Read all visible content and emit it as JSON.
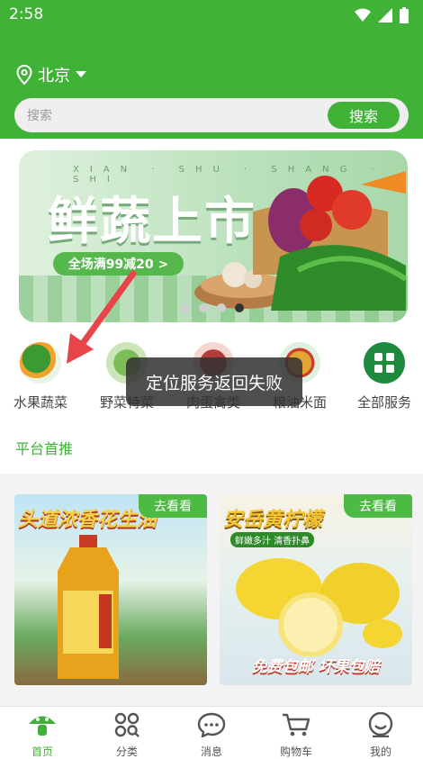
{
  "status_bar": {
    "time": "2:58"
  },
  "header": {
    "location": "北京",
    "search_placeholder": "搜索",
    "search_button": "搜索"
  },
  "banner": {
    "title": "鲜蔬上市",
    "subtitle": "XIAN · SHU · SHANG · SHI",
    "promo": "全场满99减20 >"
  },
  "categories": [
    {
      "label": "水果蔬菜"
    },
    {
      "label": "野菜特菜"
    },
    {
      "label": "肉蛋禽类"
    },
    {
      "label": "粮油米面"
    },
    {
      "label": "全部服务"
    }
  ],
  "toast": "定位服务返回失败",
  "section_title": "平台首推",
  "products": [
    {
      "title": "头道浓香花生油",
      "button": "去看看"
    },
    {
      "title": "安岳黄柠檬",
      "button": "去看看",
      "tagline": "鲜嫩多汁 清香扑鼻",
      "promo": "免费包邮  坏果包赔"
    }
  ],
  "tabbar": [
    {
      "label": "首页"
    },
    {
      "label": "分类"
    },
    {
      "label": "消息"
    },
    {
      "label": "购物车"
    },
    {
      "label": "我的"
    }
  ],
  "colors": {
    "brand_green": "#3fb237"
  }
}
